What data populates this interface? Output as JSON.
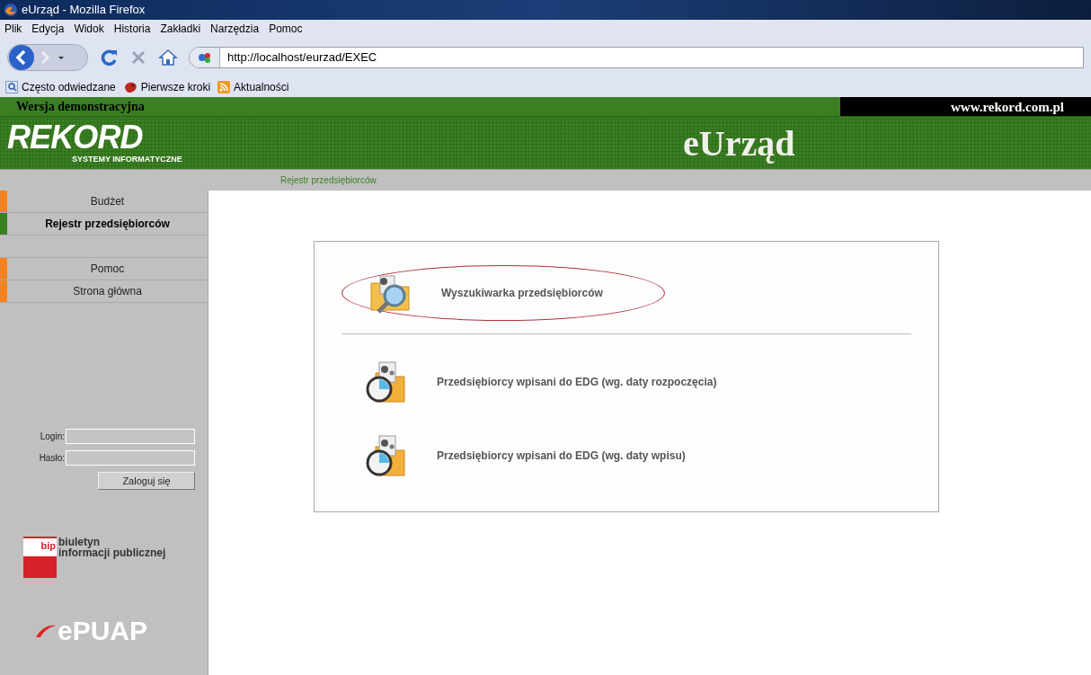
{
  "window": {
    "title": "eUrząd - Mozilla Firefox"
  },
  "menu": [
    "Plik",
    "Edycja",
    "Widok",
    "Historia",
    "Zakładki",
    "Narzędzia",
    "Pomoc"
  ],
  "toolbar": {
    "url": "http://localhost/eurzad/EXEC"
  },
  "bookmarks": [
    {
      "label": "Często odwiedzane",
      "kind": "search"
    },
    {
      "label": "Pierwsze kroki",
      "kind": "start"
    },
    {
      "label": "Aktualności",
      "kind": "feed"
    }
  ],
  "header": {
    "notice": "Wersja demonstracyjna",
    "website": "www.rekord.com.pl",
    "logo": "REKORD",
    "logo_subtitle": "SYSTEMY INFORMATYCZNE",
    "app_title": "eUrząd"
  },
  "breadcrumb": "Rejestr przedsiębiorców",
  "sidebar": {
    "items": [
      {
        "label": "Budżet",
        "selected": false
      },
      {
        "label": "Rejestr przedsiębiorców",
        "selected": true
      },
      {
        "kind": "spacer"
      },
      {
        "label": "Pomoc",
        "selected": false
      },
      {
        "label": "Strona główna",
        "selected": false
      }
    ],
    "login": {
      "login_label": "Login:",
      "password_label": "Hasło:",
      "button": "Zaloguj się"
    },
    "bip": {
      "mark": "bip",
      "line1": "biuletyn",
      "line2": "informacji publicznej"
    },
    "epuap": "ePUAP"
  },
  "content": {
    "groups": [
      [
        {
          "label": "Wyszukiwarka przedsiębiorców",
          "kind": "search",
          "highlighted": true
        }
      ],
      [
        {
          "label": "Przedsiębiorcy wpisani do EDG (wg. daty rozpoczęcia)",
          "kind": "report",
          "highlighted": false
        },
        {
          "label": "Przedsiębiorcy wpisani do EDG (wg. daty wpisu)",
          "kind": "report",
          "highlighted": false
        }
      ]
    ]
  }
}
